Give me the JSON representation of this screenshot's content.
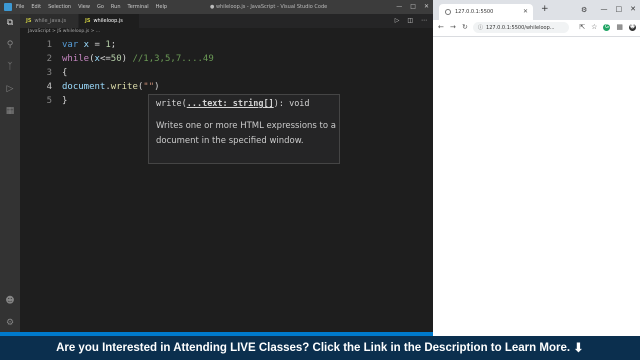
{
  "vscode": {
    "menu": [
      "File",
      "Edit",
      "Selection",
      "View",
      "Go",
      "Run",
      "Terminal",
      "Help"
    ],
    "window_title": "● whileloop.js - JavaScript - Visual Studio Code",
    "tabs": [
      {
        "label": "while_java.js",
        "active": false
      },
      {
        "label": "whileloop.js",
        "active": true
      }
    ],
    "breadcrumb": "JavaScript > JS whileloop.js > ...",
    "code_lines": [
      {
        "number": "1"
      },
      {
        "number": "2"
      },
      {
        "number": "3"
      },
      {
        "number": "4"
      },
      {
        "number": "5"
      }
    ],
    "code_tokens": {
      "l1_kw": "var",
      "l1_var": " x ",
      "l1_op": "= ",
      "l1_num": "1",
      "l1_end": ";",
      "l2_kw": "while",
      "l2_open": "(",
      "l2_var": "x",
      "l2_op": "<=",
      "l2_num": "50",
      "l2_close": ") ",
      "l2_comment": "//1,3,5,7....49",
      "l3_text": "{",
      "l4_obj": "document",
      "l4_dot": ".",
      "l4_fn": "write",
      "l4_open": "(",
      "l4_str": "\"\"",
      "l4_close": ")",
      "l5_text": "}"
    },
    "signature_help": {
      "fn": "write(",
      "param": "...text: string[]",
      "rest": "): void",
      "doc": "Writes one or more HTML expressions to a document in the specified window."
    }
  },
  "browser": {
    "tab_title": "127.0.0.1:5500",
    "url": "127.0.0.1:5500/whileloop..."
  },
  "banner": {
    "text": "Are you Interested in Attending LIVE Classes? Click the Link in the Description to Learn More.",
    "arrow": "⬇"
  },
  "colors": {
    "editor_bg": "#1e1e1e",
    "accent": "#007acc",
    "banner_bg": "#0b2f4e"
  }
}
